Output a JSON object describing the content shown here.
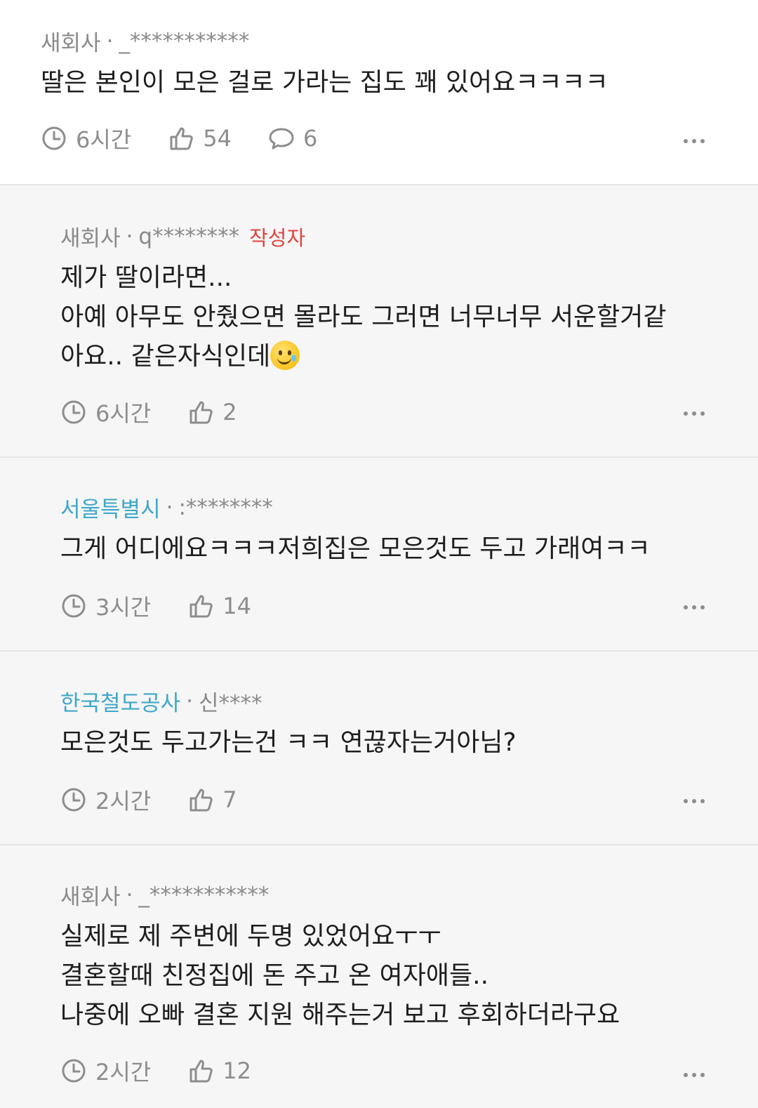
{
  "comments": [
    {
      "company": "새회사",
      "user": "_***********",
      "author_tag": "",
      "body": "딸은 본인이 모은 걸로 가라는 집도 꽤 있어요ㅋㅋㅋㅋ",
      "time": "6시간",
      "likes": "54",
      "replies": "6"
    },
    {
      "company": "새회사",
      "user": "q********",
      "author_tag": "작성자",
      "body_lines": [
        "제가 딸이라면...",
        "아예 아무도 안줬으면 몰라도 그러면 너무너무 서운할거같",
        "아요.. 같은자식인데"
      ],
      "emoji": "smiling-face-with-tear",
      "time": "6시간",
      "likes": "2"
    },
    {
      "company": "서울특별시",
      "user": ":********",
      "body": "그게 어디에요ㅋㅋㅋ저희집은 모은것도 두고 가래여ㅋㅋ",
      "time": "3시간",
      "likes": "14"
    },
    {
      "company": "한국철도공사",
      "user": "신****",
      "body": "모은것도 두고가는건 ㅋㅋ 연끊자는거아님?",
      "time": "2시간",
      "likes": "7"
    },
    {
      "company": "새회사",
      "user": "_***********",
      "body_lines": [
        "실제로 제 주변에 두명 있었어요ㅜㅜ",
        "결혼할때 친정집에 돈 주고 온 여자애들..",
        "나중에 오빠 결혼 지원 해주는거 보고 후회하더라구요"
      ],
      "time": "2시간",
      "likes": "12"
    }
  ],
  "icons": {
    "time": "clock-icon",
    "like": "thumbs-up-icon",
    "reply": "speech-bubble-icon",
    "more": "more-dots-icon"
  },
  "colors": {
    "highlight_company": "#3fa7c9",
    "author_tag": "#e0433e",
    "meta": "#8a8a8a"
  }
}
